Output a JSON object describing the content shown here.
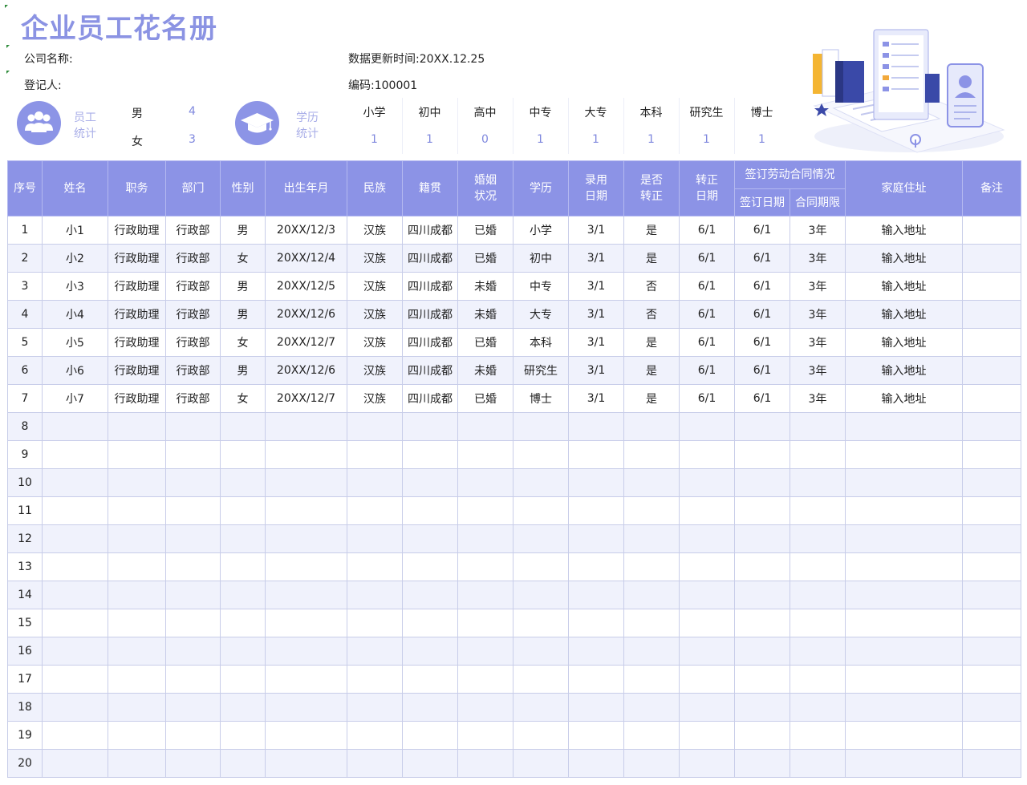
{
  "title": "企业员工花名册",
  "info": {
    "company_label": "公司名称:",
    "registrar_label": "登记人:",
    "update_label": "数据更新时间:",
    "update_value": "20XX.12.25",
    "code_label": "编码:",
    "code_value": "100001"
  },
  "staff_stats": {
    "label_line1": "员工",
    "label_line2": "统计",
    "male_label": "男",
    "male_count": "4",
    "female_label": "女",
    "female_count": "3"
  },
  "edu_stats": {
    "label_line1": "学历",
    "label_line2": "统计",
    "levels": [
      {
        "label": "小学",
        "count": "1"
      },
      {
        "label": "初中",
        "count": "1"
      },
      {
        "label": "高中",
        "count": "0"
      },
      {
        "label": "中专",
        "count": "1"
      },
      {
        "label": "大专",
        "count": "1"
      },
      {
        "label": "本科",
        "count": "1"
      },
      {
        "label": "研究生",
        "count": "1"
      },
      {
        "label": "博士",
        "count": "1"
      }
    ]
  },
  "table": {
    "headers": {
      "no": "序号",
      "name": "姓名",
      "position": "职务",
      "dept": "部门",
      "gender": "性别",
      "birth": "出生年月",
      "ethnicity": "民族",
      "native": "籍贯",
      "marital_1": "婚姻",
      "marital_2": "状况",
      "edu": "学历",
      "hire_1": "录用",
      "hire_2": "日期",
      "regular_1": "是否",
      "regular_2": "转正",
      "regdate_1": "转正",
      "regdate_2": "日期",
      "contract": "签订劳动合同情况",
      "sign_date": "签订日期",
      "term": "合同期限",
      "address": "家庭住址",
      "remark": "备注"
    },
    "rows": [
      [
        "1",
        "小1",
        "行政助理",
        "行政部",
        "男",
        "20XX/12/3",
        "汉族",
        "四川成都",
        "已婚",
        "小学",
        "3/1",
        "是",
        "6/1",
        "6/1",
        "3年",
        "输入地址",
        ""
      ],
      [
        "2",
        "小2",
        "行政助理",
        "行政部",
        "女",
        "20XX/12/4",
        "汉族",
        "四川成都",
        "已婚",
        "初中",
        "3/1",
        "是",
        "6/1",
        "6/1",
        "3年",
        "输入地址",
        ""
      ],
      [
        "3",
        "小3",
        "行政助理",
        "行政部",
        "男",
        "20XX/12/5",
        "汉族",
        "四川成都",
        "未婚",
        "中专",
        "3/1",
        "否",
        "6/1",
        "6/1",
        "3年",
        "输入地址",
        ""
      ],
      [
        "4",
        "小4",
        "行政助理",
        "行政部",
        "男",
        "20XX/12/6",
        "汉族",
        "四川成都",
        "未婚",
        "大专",
        "3/1",
        "否",
        "6/1",
        "6/1",
        "3年",
        "输入地址",
        ""
      ],
      [
        "5",
        "小5",
        "行政助理",
        "行政部",
        "女",
        "20XX/12/7",
        "汉族",
        "四川成都",
        "已婚",
        "本科",
        "3/1",
        "是",
        "6/1",
        "6/1",
        "3年",
        "输入地址",
        ""
      ],
      [
        "6",
        "小6",
        "行政助理",
        "行政部",
        "男",
        "20XX/12/6",
        "汉族",
        "四川成都",
        "未婚",
        "研究生",
        "3/1",
        "是",
        "6/1",
        "6/1",
        "3年",
        "输入地址",
        ""
      ],
      [
        "7",
        "小7",
        "行政助理",
        "行政部",
        "女",
        "20XX/12/7",
        "汉族",
        "四川成都",
        "已婚",
        "博士",
        "3/1",
        "是",
        "6/1",
        "6/1",
        "3年",
        "输入地址",
        ""
      ],
      [
        "8",
        "",
        "",
        "",
        "",
        "",
        "",
        "",
        "",
        "",
        "",
        "",
        "",
        "",
        "",
        "",
        ""
      ],
      [
        "9",
        "",
        "",
        "",
        "",
        "",
        "",
        "",
        "",
        "",
        "",
        "",
        "",
        "",
        "",
        "",
        ""
      ],
      [
        "10",
        "",
        "",
        "",
        "",
        "",
        "",
        "",
        "",
        "",
        "",
        "",
        "",
        "",
        "",
        "",
        ""
      ],
      [
        "11",
        "",
        "",
        "",
        "",
        "",
        "",
        "",
        "",
        "",
        "",
        "",
        "",
        "",
        "",
        "",
        ""
      ],
      [
        "12",
        "",
        "",
        "",
        "",
        "",
        "",
        "",
        "",
        "",
        "",
        "",
        "",
        "",
        "",
        "",
        ""
      ],
      [
        "13",
        "",
        "",
        "",
        "",
        "",
        "",
        "",
        "",
        "",
        "",
        "",
        "",
        "",
        "",
        "",
        ""
      ],
      [
        "14",
        "",
        "",
        "",
        "",
        "",
        "",
        "",
        "",
        "",
        "",
        "",
        "",
        "",
        "",
        "",
        ""
      ],
      [
        "15",
        "",
        "",
        "",
        "",
        "",
        "",
        "",
        "",
        "",
        "",
        "",
        "",
        "",
        "",
        "",
        ""
      ],
      [
        "16",
        "",
        "",
        "",
        "",
        "",
        "",
        "",
        "",
        "",
        "",
        "",
        "",
        "",
        "",
        "",
        ""
      ],
      [
        "17",
        "",
        "",
        "",
        "",
        "",
        "",
        "",
        "",
        "",
        "",
        "",
        "",
        "",
        "",
        "",
        ""
      ],
      [
        "18",
        "",
        "",
        "",
        "",
        "",
        "",
        "",
        "",
        "",
        "",
        "",
        "",
        "",
        "",
        "",
        ""
      ],
      [
        "19",
        "",
        "",
        "",
        "",
        "",
        "",
        "",
        "",
        "",
        "",
        "",
        "",
        "",
        "",
        "",
        ""
      ],
      [
        "20",
        "",
        "",
        "",
        "",
        "",
        "",
        "",
        "",
        "",
        "",
        "",
        "",
        "",
        "",
        "",
        ""
      ]
    ]
  },
  "colors": {
    "accent": "#8c93e6",
    "title": "#8b93e3",
    "row_alt": "#f0f2fc"
  }
}
